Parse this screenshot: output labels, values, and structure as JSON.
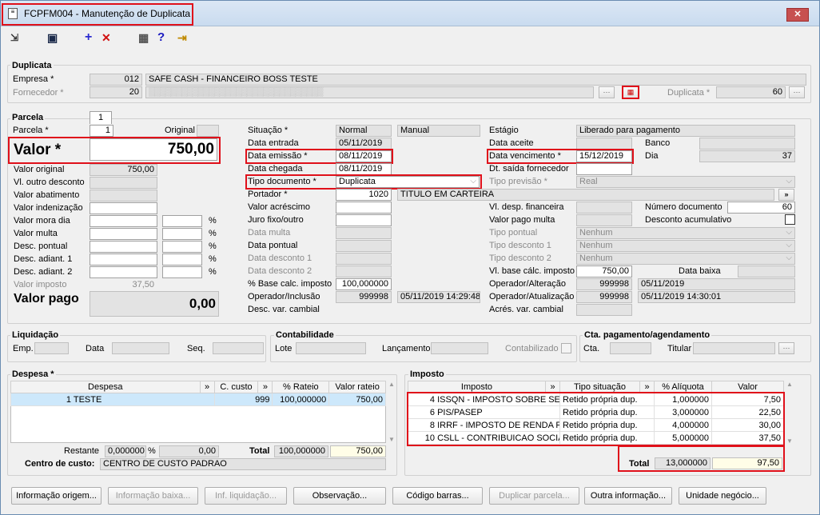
{
  "window": {
    "title": "FCPFM004 - Manutenção de Duplicata",
    "close_label": "✕"
  },
  "toolbar": {
    "expand": "⇲",
    "save": "▣",
    "add": "+",
    "delete": "✕",
    "calc": "▦",
    "help": "?",
    "exit": "⇥"
  },
  "duplicata": {
    "title": "Duplicata",
    "empresa_label": "Empresa *",
    "empresa_code": "012",
    "empresa_name": "SAFE CASH - FINANCEIRO BOSS TESTE",
    "fornecedor_label": "Fornecedor *",
    "fornecedor_code": "20",
    "fornecedor_name": "▒▒▒▒▒▒▒▒▒▒▒▒▒▒▒▒▒▒▒▒▒▒▒▒▒▒▒▒▒▒▒▒",
    "duplicata_label": "Duplicata *",
    "duplicata_value": "60"
  },
  "parcela": {
    "title": "Parcela",
    "tab": "1",
    "parcela_label": "Parcela *",
    "parcela_value": "1",
    "original_label": "Original",
    "valor_label": "Valor *",
    "valor_value": "750,00",
    "valor_original_label": "Valor original",
    "valor_original_value": "750,00",
    "outro_desc_label": "Vl. outro desconto",
    "abatimento_label": "Valor abatimento",
    "indenizacao_label": "Valor indenização",
    "mora_label": "Valor mora dia",
    "multa_label": "Valor multa",
    "desc_pontual_label": "Desc. pontual",
    "desc_adiant1_label": "Desc. adiant. 1",
    "desc_adiant2_label": "Desc. adiant. 2",
    "valor_imposto_label": "Valor imposto",
    "valor_imposto_value": "37,50",
    "valor_pago_label": "Valor pago",
    "valor_pago_value": "0,00",
    "pct": "%"
  },
  "mid": {
    "situacao_label": "Situação *",
    "situacao_value": "Normal",
    "situacao_tipo": "Manual",
    "data_entrada_label": "Data entrada",
    "data_entrada": "05/11/2019",
    "data_emissao_label": "Data emissão *",
    "data_emissao": "08/11/2019",
    "data_chegada_label": "Data chegada",
    "data_chegada": "08/11/2019",
    "tipo_doc_label": "Tipo documento *",
    "tipo_doc": "Duplicata",
    "portador_label": "Portador *",
    "portador_code": "1020",
    "portador_name": "TITULO EM CARTEIRA",
    "acrescimo_label": "Valor acréscimo",
    "juro_label": "Juro fixo/outro",
    "data_multa_label": "Data multa",
    "data_pontual_label": "Data pontual",
    "data_desc1_label": "Data desconto 1",
    "data_desc2_label": "Data desconto 2",
    "base_calc_label": "% Base calc. imposto",
    "base_calc_value": "100,000000",
    "op_inclusao_label": "Operador/Inclusão",
    "op_inclusao_code": "999998",
    "op_inclusao_date": "05/11/2019 14:29:48",
    "desc_var_label": "Desc. var. cambial"
  },
  "right": {
    "estagio_label": "Estágio",
    "estagio_value": "Liberado para pagamento",
    "data_aceite_label": "Data aceite",
    "banco_label": "Banco",
    "data_venc_label": "Data vencimento *",
    "data_venc": "15/12/2019",
    "dia_label": "Dia",
    "dia_value": "37",
    "dt_saida_label": "Dt. saída fornecedor",
    "tipo_prev_label": "Tipo previsão *",
    "tipo_prev": "Real",
    "vl_desp_label": "Vl. desp. financeira",
    "num_doc_label": "Número documento",
    "num_doc": "60",
    "vl_pago_multa_label": "Valor pago multa",
    "desc_acum_label": "Desconto acumulativo",
    "tipo_pontual_label": "Tipo pontual",
    "tipo_pontual": "Nenhum",
    "tipo_desc1_label": "Tipo desconto 1",
    "tipo_desc1": "Nenhum",
    "tipo_desc2_label": "Tipo desconto 2",
    "tipo_desc2": "Nenhum",
    "vl_base_label": "Vl. base cálc. imposto",
    "vl_base": "750,00",
    "data_baixa_label": "Data baixa",
    "op_alt_label": "Operador/Alteração",
    "op_alt_code": "999998",
    "op_alt_date": "05/11/2019",
    "op_atu_label": "Operador/Atualização",
    "op_atu_code": "999998",
    "op_atu_date": "05/11/2019 14:30:01",
    "acres_var_label": "Acrés. var. cambial",
    "arrow": "»"
  },
  "liquidacao": {
    "title": "Liquidação",
    "emp_label": "Emp.",
    "data_label": "Data",
    "seq_label": "Seq."
  },
  "contabilidade": {
    "title": "Contabilidade",
    "lote_label": "Lote",
    "lancamento_label": "Lançamento",
    "contabilizado_label": "Contabilizado"
  },
  "cta": {
    "title": "Cta. pagamento/agendamento",
    "cta_label": "Cta.",
    "titular_label": "Titular"
  },
  "despesa": {
    "title": "Despesa *",
    "headers": [
      "Despesa",
      "»",
      "C. custo",
      "»",
      "% Rateio",
      "Valor rateio"
    ],
    "rows": [
      {
        "num": "1",
        "name": "TESTE",
        "ccusto": "999",
        "rateio": "100,000000",
        "valor": "750,00"
      }
    ],
    "restante_label": "Restante",
    "restante_pct": "0,000000",
    "restante_val": "0,00",
    "total_label": "Total",
    "total_pct": "100,000000",
    "total_val": "750,00",
    "centro_label": "Centro de custo:",
    "centro_value": "CENTRO DE CUSTO PADRAO",
    "pct": "%"
  },
  "imposto": {
    "title": "Imposto",
    "headers": [
      "Imposto",
      "»",
      "Tipo situação",
      "»",
      "% Alíquota",
      "Valor"
    ],
    "rows": [
      {
        "num": "4",
        "name": "ISSQN - IMPOSTO SOBRE SERV",
        "tipo": "Retido própria dup.",
        "aliq": "1,000000",
        "valor": "7,50"
      },
      {
        "num": "6",
        "name": "PIS/PASEP",
        "tipo": "Retido própria dup.",
        "aliq": "3,000000",
        "valor": "22,50"
      },
      {
        "num": "8",
        "name": "IRRF - IMPOSTO DE RENDA RET",
        "tipo": "Retido própria dup.",
        "aliq": "4,000000",
        "valor": "30,00"
      },
      {
        "num": "10",
        "name": "CSLL - CONTRIBUICAO SOCIAL",
        "tipo": "Retido própria dup.",
        "aliq": "5,000000",
        "valor": "37,50"
      }
    ],
    "total_label": "Total",
    "total_aliq": "13,000000",
    "total_val": "97,50"
  },
  "buttons": [
    "Informação origem...",
    "Informação baixa...",
    "Inf. liquidação...",
    "Observação...",
    "Código barras...",
    "Duplicar parcela...",
    "Outra informação...",
    "Unidade negócio..."
  ]
}
